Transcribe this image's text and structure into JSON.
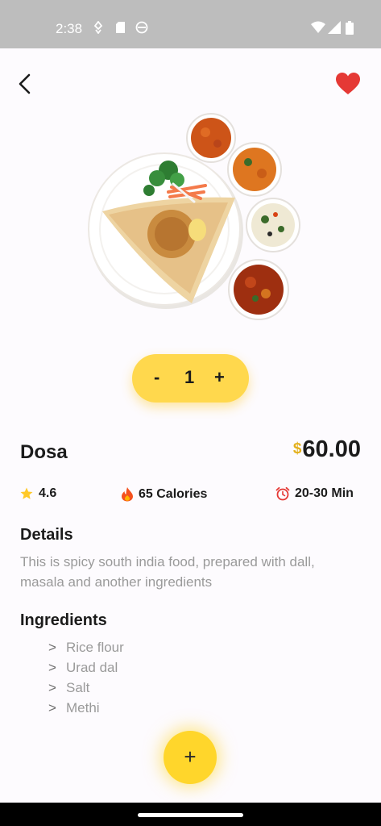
{
  "status": {
    "time": "2:38"
  },
  "product": {
    "name": "Dosa",
    "currency": "$",
    "price": "60.00"
  },
  "quantity": {
    "minus": "-",
    "value": "1",
    "plus": "+"
  },
  "stats": {
    "rating": "4.6",
    "calories": "65 Calories",
    "time": "20-30 Min"
  },
  "details": {
    "heading": "Details",
    "text": "This is spicy south india food, prepared with dall, masala and another ingredients"
  },
  "ingredients": {
    "heading": "Ingredients",
    "marker": ">",
    "items": [
      "Rice flour",
      "Urad dal",
      "Salt",
      "Methi"
    ]
  },
  "fab": {
    "label": "+"
  },
  "colors": {
    "accent": "#ffd84d",
    "favorite": "#e53935",
    "text": "#1b1b1b",
    "muted": "#9a9a9a"
  },
  "icons": [
    "back-icon",
    "heart-icon",
    "star-icon",
    "fire-icon",
    "alarm-clock-icon",
    "plus-icon"
  ]
}
